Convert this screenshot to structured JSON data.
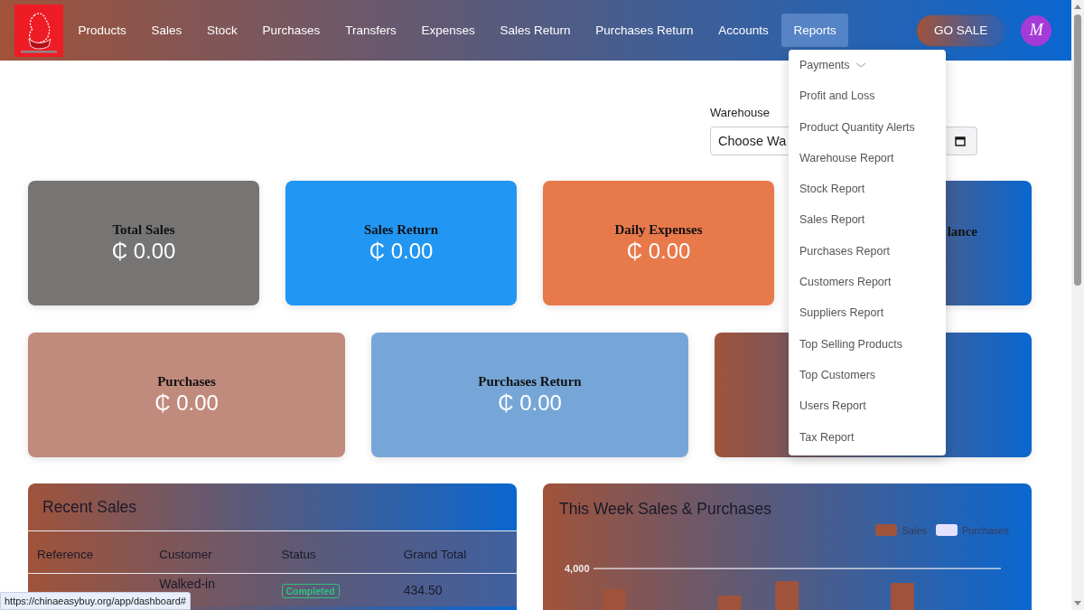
{
  "nav": {
    "items": [
      {
        "label": "Products",
        "selected": false
      },
      {
        "label": "Sales",
        "selected": false
      },
      {
        "label": "Stock",
        "selected": false
      },
      {
        "label": "Purchases",
        "selected": false
      },
      {
        "label": "Transfers",
        "selected": false
      },
      {
        "label": "Expenses",
        "selected": false
      },
      {
        "label": "Sales Return",
        "selected": false
      },
      {
        "label": "Purchases Return",
        "selected": false
      },
      {
        "label": "Accounts",
        "selected": false
      },
      {
        "label": "Reports",
        "selected": true
      }
    ],
    "go_sale": "GO SALE",
    "avatar": "M"
  },
  "reports_menu": [
    {
      "label": "Payments",
      "expanded": false
    },
    {
      "label": "Profit and Loss"
    },
    {
      "label": "Product Quantity Alerts"
    },
    {
      "label": "Warehouse Report"
    },
    {
      "label": "Stock Report"
    },
    {
      "label": "Sales Report"
    },
    {
      "label": "Purchases Report"
    },
    {
      "label": "Customers Report"
    },
    {
      "label": "Suppliers Report"
    },
    {
      "label": "Top Selling Products"
    },
    {
      "label": "Top Customers"
    },
    {
      "label": "Users Report"
    },
    {
      "label": "Tax Report"
    }
  ],
  "filter": {
    "label": "Warehouse",
    "value": "Choose Wa"
  },
  "cards_row_1": [
    {
      "kind": "solid",
      "color": "#777474",
      "title": "Total Sales",
      "amount": "₵ 0.00"
    },
    {
      "kind": "solid",
      "color": "#2196f3",
      "title": "Sales Return",
      "amount": "₵ 0.00"
    },
    {
      "kind": "solid",
      "color": "#e8794b",
      "title": "Daily Expenses",
      "amount": "₵ 0.00"
    },
    {
      "kind": "gradient",
      "title": "lance"
    }
  ],
  "cards_row_2": [
    {
      "kind": "solid",
      "color": "#c08a7c",
      "title": "Purchases",
      "amount": "₵ 0.00"
    },
    {
      "kind": "solid",
      "color": "#76a6d8",
      "title": "Purchases Return",
      "amount": "₵ 0.00"
    },
    {
      "kind": "gradient"
    }
  ],
  "recent_sales": {
    "title": "Recent Sales",
    "columns": [
      "Reference",
      "Customer",
      "Status",
      "Grand Total"
    ],
    "rows": [
      {
        "customer": "Walked-in",
        "status": "Completed",
        "grand_total": "434.50"
      }
    ]
  },
  "weekly_chart": {
    "title": "This Week Sales & Purchases",
    "legend": [
      {
        "label": "Sales",
        "color": "#a0533a"
      },
      {
        "label": "Purchases",
        "color": "#e6e0ff"
      }
    ],
    "tick": "4,000"
  },
  "status_url": "https://chinaeasybuy.org/app/dashboard#"
}
